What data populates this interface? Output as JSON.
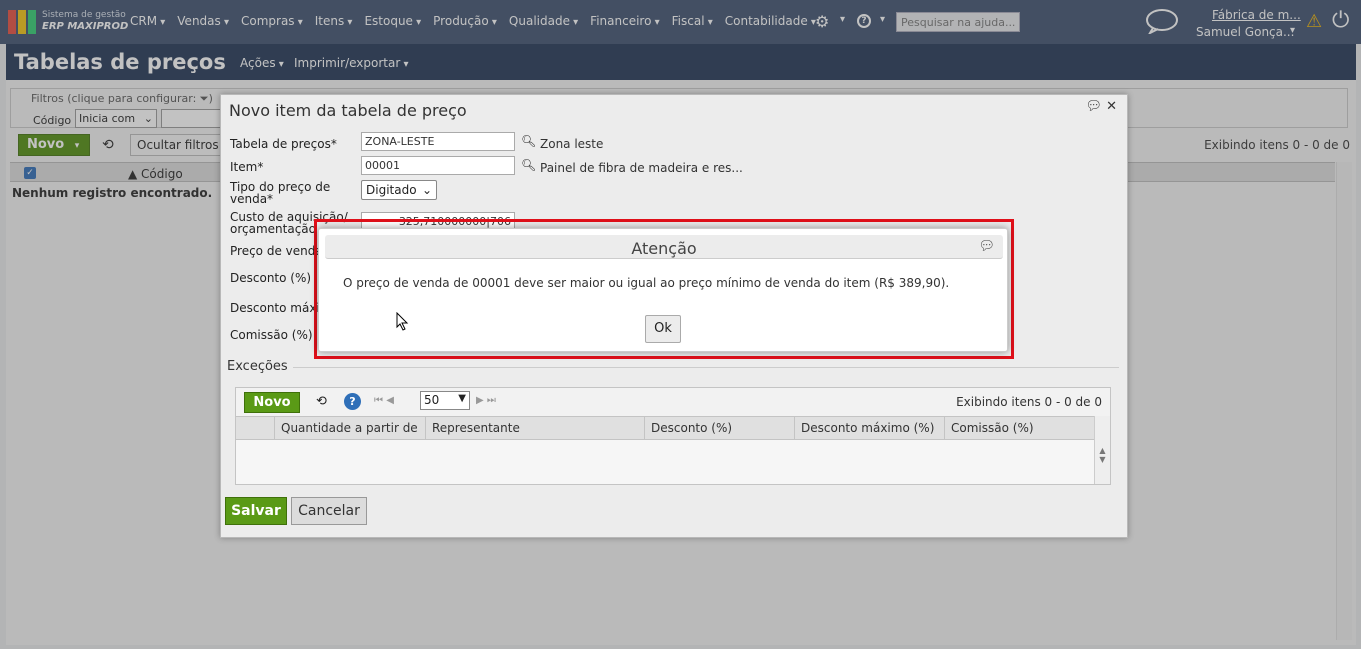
{
  "header": {
    "logo_line1": "Sistema de gestão",
    "logo_line2": "ERP MAXIPROD",
    "menu": [
      "CRM",
      "Vendas",
      "Compras",
      "Itens",
      "Estoque",
      "Produção",
      "Qualidade",
      "Financeiro",
      "Fiscal",
      "Contabilidade"
    ],
    "search_placeholder": "Pesquisar na ajuda...",
    "company": "Fábrica de m...",
    "user": "Samuel Gonça..."
  },
  "page": {
    "title": "Tabelas de preços",
    "acoes": "Ações",
    "imprimir": "Imprimir/exportar"
  },
  "filters": {
    "legend": "Filtros (clique para configurar:",
    "codigo_label": "Código",
    "operator": "Inicia com"
  },
  "toolbar": {
    "novo": "Novo",
    "ocultar": "Ocultar filtros",
    "exibindo": "Exibindo itens 0 - 0 de 0"
  },
  "grid": {
    "col_codigo": "▲ Código",
    "empty": "Nenhum registro encontrado."
  },
  "form": {
    "title": "Novo item da tabela de preço",
    "tabela_label": "Tabela de preços*",
    "tabela_value": "ZONA-LESTE",
    "tabela_desc": "Zona leste",
    "item_label": "Item*",
    "item_value": "00001",
    "item_desc": "Painel de fibra de madeira e res...",
    "tipo_label_1": "Tipo do preço de",
    "tipo_label_2": "venda*",
    "tipo_value": "Digitado",
    "custo_label_1": "Custo de aquisição/",
    "custo_label_2": "orçamentação",
    "custo_value": "325,710000000|706",
    "preco_label": "Preço de venda*",
    "desconto_label": "Desconto (%)",
    "desconto_max_label": "Desconto máximo",
    "comissao_label": "Comissão (%)",
    "excecoes": "Exceções",
    "exc_novo": "Novo",
    "exc_pagesize": "50",
    "exc_exibindo": "Exibindo itens 0 - 0 de 0",
    "exc_cols": [
      "Quantidade a partir de",
      "Representante",
      "Desconto (%)",
      "Desconto máximo (%)",
      "Comissão (%)"
    ],
    "salvar": "Salvar",
    "cancelar": "Cancelar"
  },
  "alert": {
    "title": "Atenção",
    "message": "O preço de venda de 00001 deve ser maior ou igual ao preço mínimo de venda do item (R$ 389,90).",
    "ok": "Ok"
  },
  "colors": {
    "nav_bg": "#3c4f6e",
    "title_bg": "#1f3454",
    "green": "#5a9a16",
    "alert_border": "#e0101a"
  }
}
